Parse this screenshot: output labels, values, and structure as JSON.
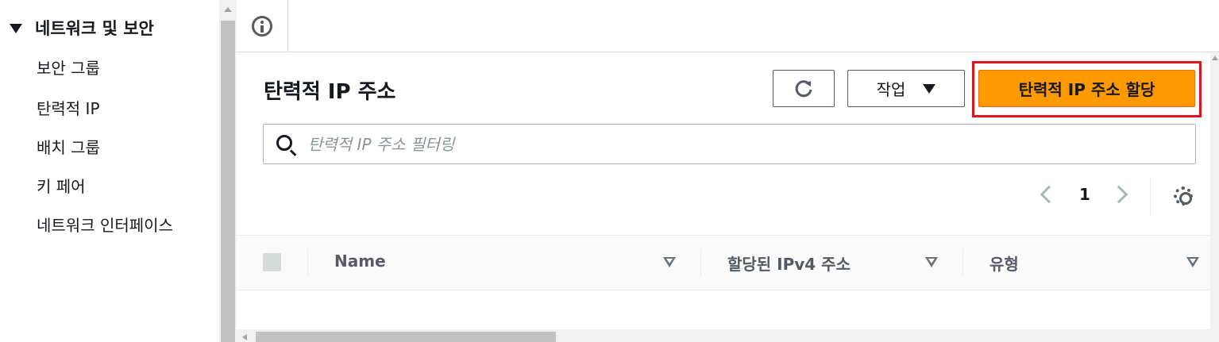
{
  "sidebar": {
    "section_title": "네트워크 및 보안",
    "items": [
      {
        "label": "보안 그룹"
      },
      {
        "label": "탄력적 IP"
      },
      {
        "label": "배치 그룹"
      },
      {
        "label": "키 페어"
      },
      {
        "label": "네트워크 인터페이스"
      }
    ]
  },
  "topbar": {
    "info_icon": "info-circle-icon"
  },
  "main": {
    "title": "탄력적 IP 주소",
    "refresh_icon": "refresh-icon",
    "actions_label": "작업",
    "primary_label": "탄력적 IP 주소 할당",
    "search": {
      "placeholder": "탄력적 IP 주소 필터링",
      "value": ""
    },
    "pagination": {
      "current_page": "1"
    },
    "table": {
      "columns": [
        {
          "label": "Name"
        },
        {
          "label": "할당된 IPv4 주소"
        },
        {
          "label": "유형"
        }
      ]
    }
  },
  "colors": {
    "primary": "#ff9900",
    "highlight_border": "#e0141e",
    "text": "#16191f",
    "muted": "#545b64"
  }
}
